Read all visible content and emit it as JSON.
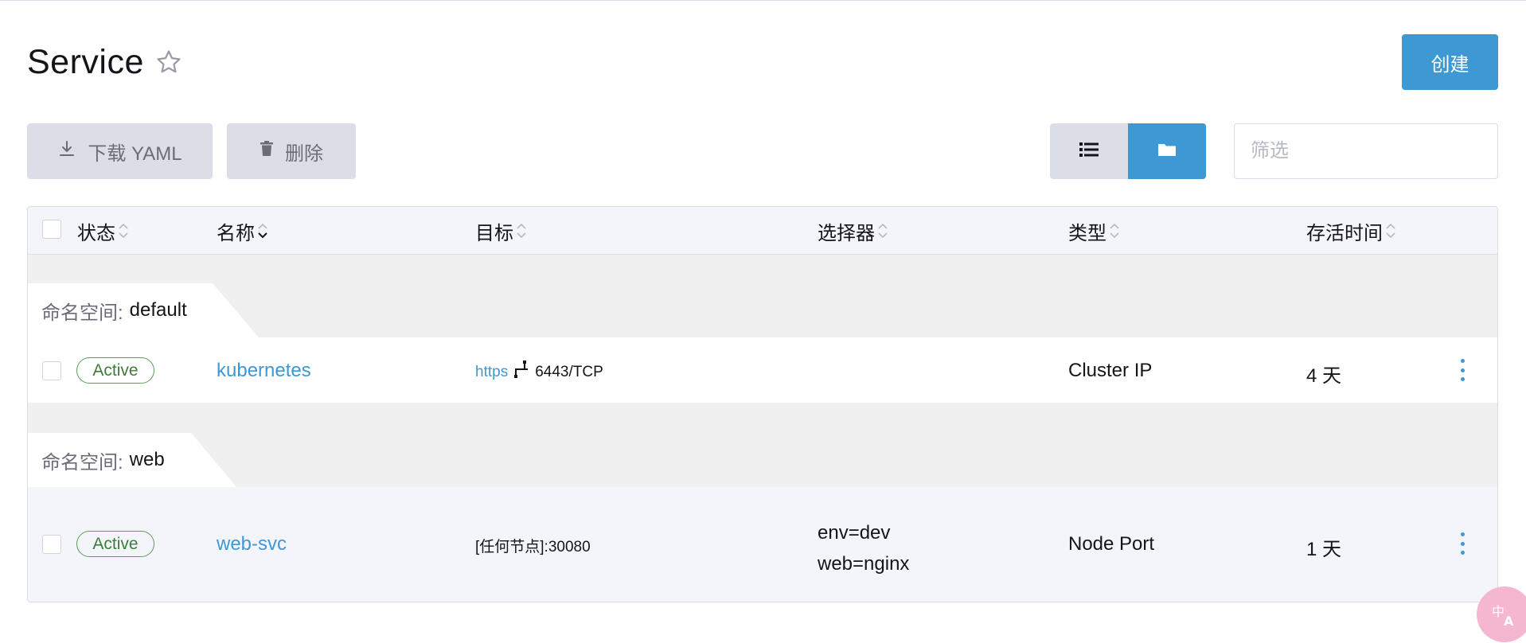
{
  "page": {
    "title": "Service",
    "create_label": "创建"
  },
  "toolbar": {
    "download_label": "下载 YAML",
    "delete_label": "删除",
    "filter_placeholder": "筛选"
  },
  "table": {
    "columns": [
      "状态",
      "名称",
      "目标",
      "选择器",
      "类型",
      "存活时间"
    ],
    "groups": [
      {
        "label": "命名空间:",
        "namespace": "default",
        "rows": [
          {
            "status": "Active",
            "name": "kubernetes",
            "target_protocol": "https",
            "target_port": "6443/TCP",
            "selector": [],
            "type": "Cluster IP",
            "age": "4 天"
          }
        ]
      },
      {
        "label": "命名空间:",
        "namespace": "web",
        "rows": [
          {
            "status": "Active",
            "name": "web-svc",
            "target": "[任何节点]:30080",
            "selector": [
              "env=dev",
              "web=nginx"
            ],
            "type": "Node Port",
            "age": "1 天"
          }
        ]
      }
    ]
  },
  "colors": {
    "accent": "#3d98d3",
    "active_green": "#5a9c55",
    "button_gray": "#dcdee7",
    "group_band": "#f0f0f0"
  },
  "icons": [
    "star-icon",
    "download-icon",
    "trash-icon",
    "list-icon",
    "folder-icon",
    "sort-icon",
    "network-icon",
    "kebab-menu-icon",
    "translate-icon"
  ]
}
